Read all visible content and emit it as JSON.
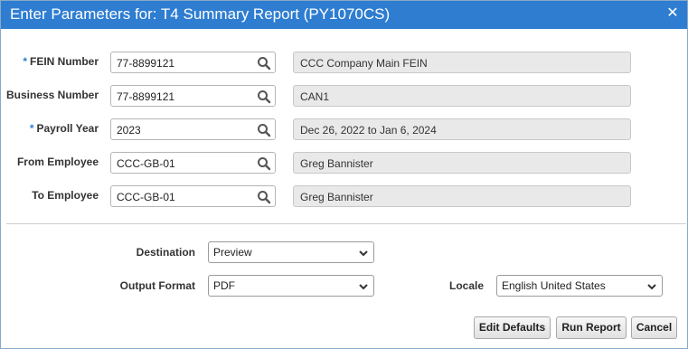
{
  "dialog": {
    "title": "Enter Parameters for: T4 Summary Report (PY1070CS)",
    "close_icon": "close-icon"
  },
  "fields": [
    {
      "label": "FEIN Number",
      "required": true,
      "value": "77-8899121",
      "description": "CCC Company Main FEIN"
    },
    {
      "label": "Business Number",
      "required": false,
      "value": "77-8899121",
      "description": "CAN1"
    },
    {
      "label": "Payroll Year",
      "required": true,
      "value": "2023",
      "description": "Dec 26, 2022 to Jan 6, 2024"
    },
    {
      "label": "From Employee",
      "required": false,
      "value": "CCC-GB-01",
      "description": "Greg Bannister"
    },
    {
      "label": "To Employee",
      "required": false,
      "value": "CCC-GB-01",
      "description": "Greg Bannister"
    }
  ],
  "required_marker": "*",
  "output": {
    "destination_label": "Destination",
    "destination_value": "Preview",
    "format_label": "Output Format",
    "format_value": "PDF",
    "locale_label": "Locale",
    "locale_value": "English United States"
  },
  "buttons": {
    "edit_defaults": "Edit Defaults",
    "run_report": "Run Report",
    "cancel": "Cancel"
  },
  "colors": {
    "titlebar": "#2e7dd1",
    "required_marker": "#2e7dd1",
    "readonly_bg": "#e9e9e9"
  }
}
